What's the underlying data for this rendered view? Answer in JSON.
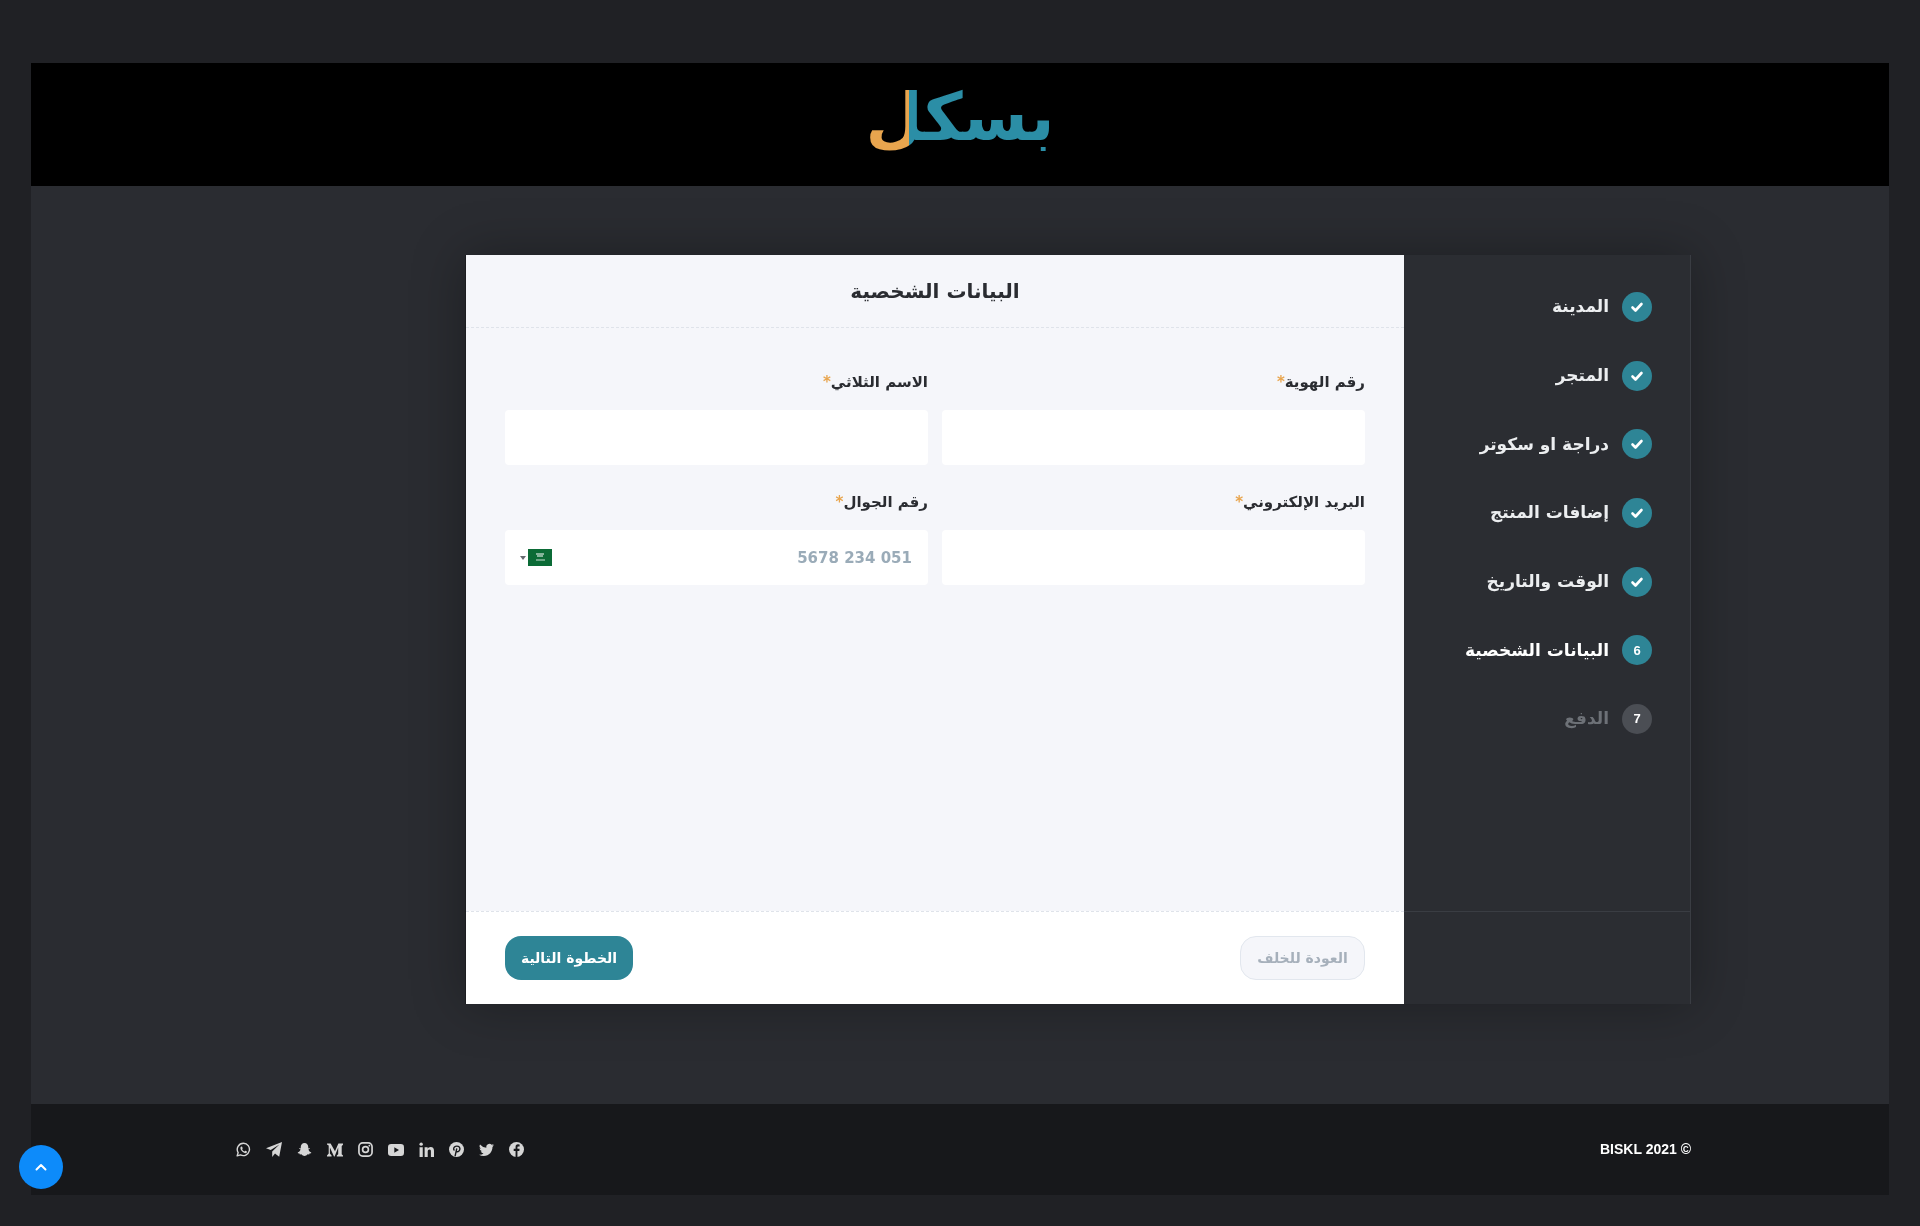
{
  "header": {
    "logo": "بسكل"
  },
  "steps": [
    {
      "label": "المدينة",
      "completed": true,
      "selected": false
    },
    {
      "label": "المتجر",
      "completed": true,
      "selected": false
    },
    {
      "label": "دراجة او سكوتر",
      "completed": true,
      "selected": false
    },
    {
      "label": "إضافات المنتج",
      "completed": true,
      "selected": false
    },
    {
      "label": "الوقت والتاريخ",
      "completed": true,
      "selected": false
    },
    {
      "label": "البيانات الشخصية",
      "completed": false,
      "selected": true,
      "number": "6"
    },
    {
      "label": "الدفع",
      "completed": false,
      "selected": false,
      "number": "7"
    }
  ],
  "form": {
    "title": "البيانات الشخصية",
    "fields": [
      {
        "kind": "text",
        "label": "رقم الهوية",
        "required_mark": "*"
      },
      {
        "kind": "text",
        "label": "الاسم الثلاثي",
        "required_mark": "*"
      },
      {
        "kind": "text",
        "label": "البريد الإلكتروني",
        "required_mark": "*"
      },
      {
        "kind": "phone",
        "label": "رقم الجوال",
        "required_mark": "*",
        "placeholder": "5678 234 051"
      }
    ],
    "buttons": [
      {
        "kind": "back",
        "label": "العودة للخلف",
        "disabled": true
      },
      {
        "kind": "next",
        "label": "الخطوة التالية",
        "disabled": false
      }
    ]
  },
  "footer": {
    "copyright": "BISKL 2021 ©"
  }
}
